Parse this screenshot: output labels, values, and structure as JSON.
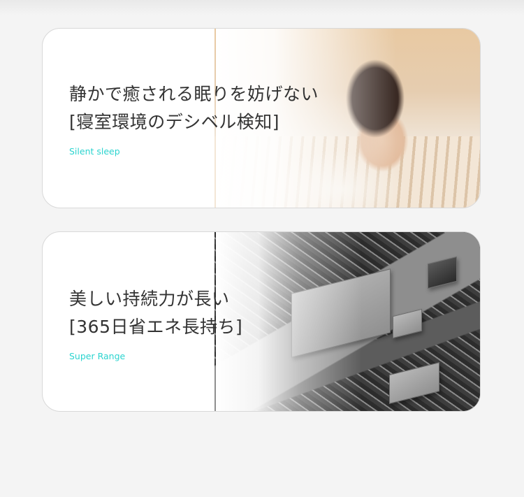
{
  "accent_color": "#2bd4cf",
  "cards": [
    {
      "title_line1": "静かで癒される眠りを妨げない",
      "title_line2": "[寝室環境のデシベル検知]",
      "subtitle": "Silent sleep",
      "image": "woman-sleeping-on-pillow"
    },
    {
      "title_line1": "美しい持続力が長い",
      "title_line2": "[365日省エネ長持ち]",
      "subtitle": "Super  Range",
      "image": "circuit-board-chips"
    }
  ]
}
